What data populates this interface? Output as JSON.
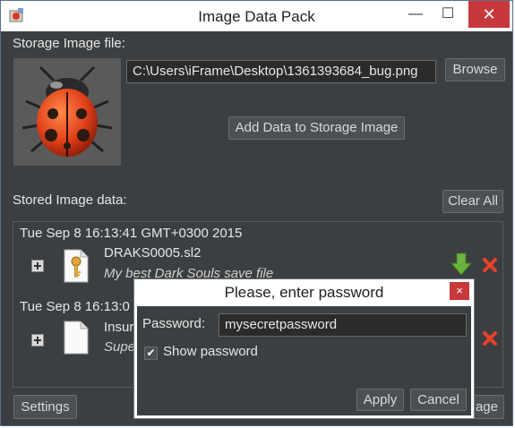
{
  "window": {
    "title": "Image Data Pack"
  },
  "storage": {
    "label": "Storage Image file:",
    "path": "C:\\Users\\iFrame\\Desktop\\1361393684_bug.png",
    "browse_label": "Browse",
    "add_label": "Add Data to Storage Image"
  },
  "stored": {
    "label": "Stored Image data:",
    "clear_label": "Clear All",
    "entries": [
      {
        "date": "Tue Sep 8 16:13:41 GMT+0300 2015",
        "filename": "DRAKS0005.sl2",
        "description": "My best Dark Souls save file"
      },
      {
        "date": "Tue Sep 8 16:13:0",
        "filename": "Insur",
        "description": "Supe"
      }
    ]
  },
  "bottom": {
    "settings_label": "Settings",
    "partial_button_label": "age"
  },
  "dialog": {
    "title": "Please, enter password",
    "close_glyph": "×",
    "password_label": "Password:",
    "password_value": "mysecretpassword",
    "show_password_label": "Show password",
    "show_password_checked": "✔",
    "apply_label": "Apply",
    "cancel_label": "Cancel"
  },
  "titlebar_glyphs": {
    "minimize": "—",
    "maximize": "☐",
    "close": "✕"
  },
  "colors": {
    "background": "#3c3f41",
    "close_red": "#c7383b",
    "download_green": "#6cb33f",
    "delete_red": "#e8412c"
  }
}
